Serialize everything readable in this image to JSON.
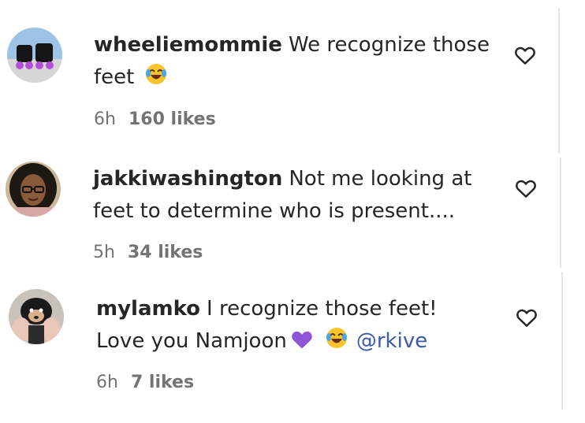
{
  "comments": [
    {
      "username": "wheeliemommie",
      "text": "We recognize those feet",
      "emojis": [
        "face-with-tears-of-joy"
      ],
      "time": "6h",
      "likes": "160 likes",
      "avatar": "roller-skates-photo",
      "like_icon": "heart-outline-icon"
    },
    {
      "username": "jakkiwashington",
      "text": "Not me looking at feet to determine who is present....",
      "emojis": [],
      "time": "5h",
      "likes": "34 likes",
      "avatar": "person-with-glasses-photo",
      "like_icon": "heart-outline-icon"
    },
    {
      "username": "mylamko",
      "text_line1": "I recognize those feet!",
      "text_line2": "Love you Namjoon",
      "emojis": [
        "purple-heart",
        "face-with-tears-of-joy"
      ],
      "mention": "@rkive",
      "time": "6h",
      "likes": "7 likes",
      "avatar": "small-dog-photo",
      "like_icon": "heart-outline-icon"
    }
  ],
  "colors": {
    "text": "#262626",
    "secondary": "#737373",
    "mention": "#3b5aa8",
    "purple_heart": "#8e55d6",
    "emoji_face": "#f7c42b"
  }
}
